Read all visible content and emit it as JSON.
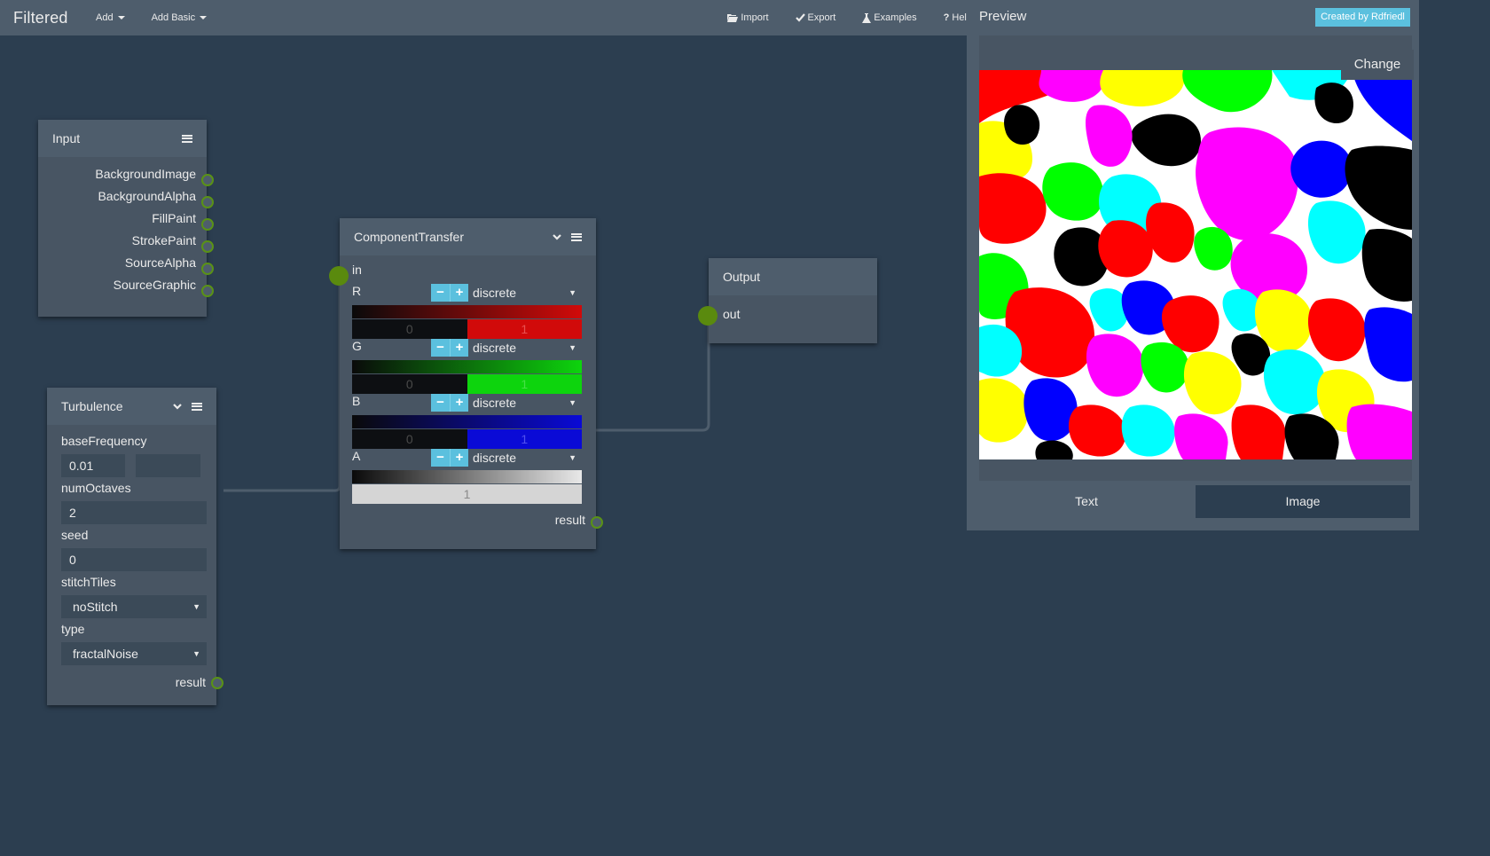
{
  "app": {
    "title": "Filtered",
    "menus": [
      {
        "label": "Add"
      },
      {
        "label": "Add Basic"
      }
    ],
    "links": [
      {
        "label": "Import",
        "icon": "folder-open-icon"
      },
      {
        "label": "Export",
        "icon": "check-icon"
      },
      {
        "label": "Examples",
        "icon": "flask-icon"
      },
      {
        "label": "Help",
        "icon": "question-icon"
      }
    ]
  },
  "nodes": {
    "input": {
      "title": "Input",
      "outputs": [
        "BackgroundImage",
        "BackgroundAlpha",
        "FillPaint",
        "StrokePaint",
        "SourceAlpha",
        "SourceGraphic"
      ]
    },
    "turbulence": {
      "title": "Turbulence",
      "fields": {
        "baseFrequency": {
          "label": "baseFrequency",
          "value": "0.01",
          "value2": ""
        },
        "numOctaves": {
          "label": "numOctaves",
          "value": "2"
        },
        "seed": {
          "label": "seed",
          "value": "0"
        },
        "stitchTiles": {
          "label": "stitchTiles",
          "value": "noStitch"
        },
        "type": {
          "label": "type",
          "value": "fractalNoise"
        }
      },
      "result_label": "result"
    },
    "component_transfer": {
      "title": "ComponentTransfer",
      "input_label": "in",
      "channels": [
        {
          "name": "R",
          "mode": "discrete",
          "values": [
            "0",
            "1"
          ],
          "color": "#d10a0a"
        },
        {
          "name": "G",
          "mode": "discrete",
          "values": [
            "0",
            "1"
          ],
          "color": "#0dd40d"
        },
        {
          "name": "B",
          "mode": "discrete",
          "values": [
            "0",
            "1"
          ],
          "color": "#0a0ad6"
        },
        {
          "name": "A",
          "mode": "discrete",
          "values": [
            "1"
          ],
          "color": "#d5d5d5"
        }
      ],
      "result_label": "result"
    },
    "output": {
      "title": "Output",
      "input_label": "out"
    }
  },
  "preview": {
    "title": "Preview",
    "badge": "Created by Rdfriedl",
    "change_label": "Change",
    "tabs": [
      {
        "label": "Text",
        "active": false
      },
      {
        "label": "Image",
        "active": true
      }
    ]
  },
  "colors": {
    "background": "#2c3e50",
    "panel": "#4e5d6c",
    "accent": "#5bc0de",
    "port": "#5a9216"
  }
}
